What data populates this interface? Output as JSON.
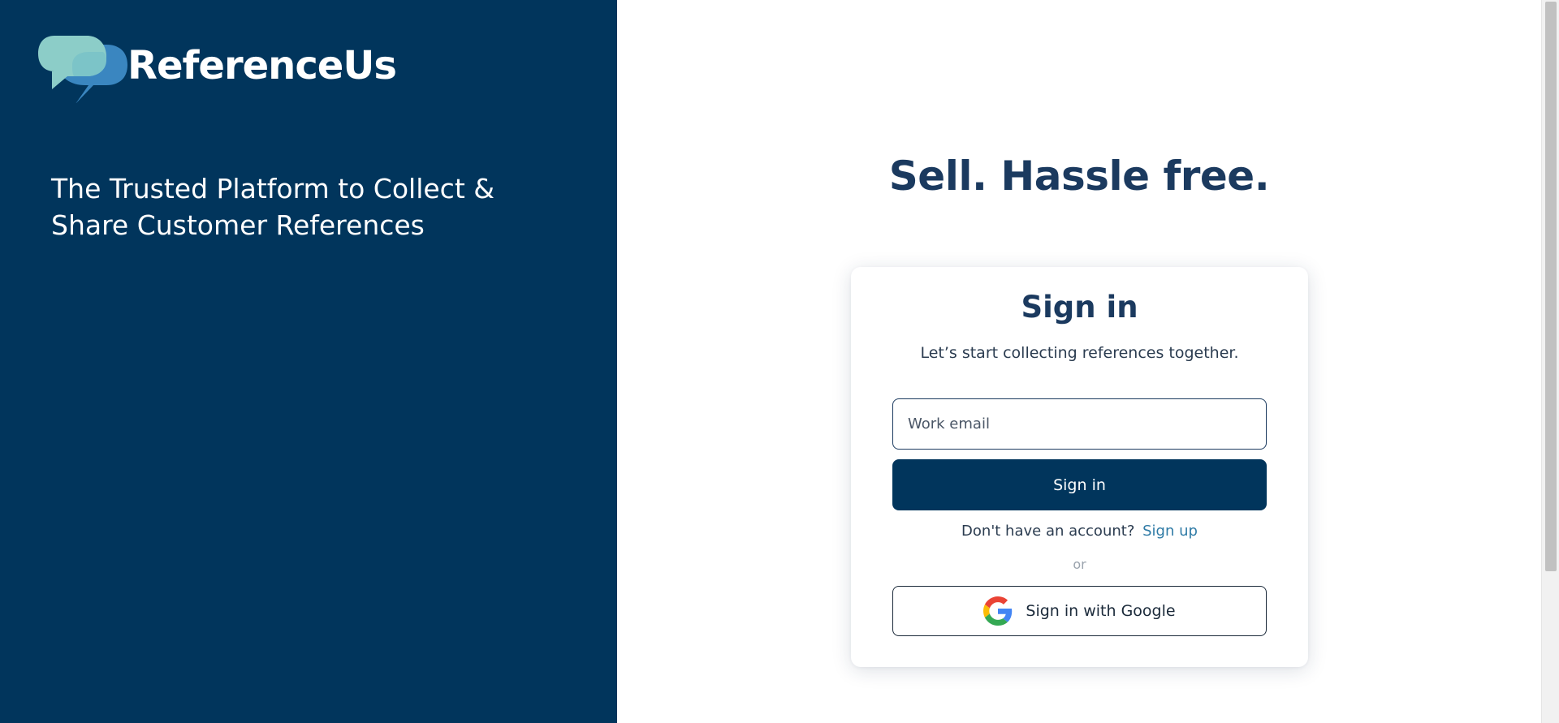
{
  "brand": {
    "name": "ReferenceUs",
    "tagline": "The Trusted Platform to Collect & Share Customer References",
    "logo_icon": "speech-bubbles-icon"
  },
  "hero": {
    "headline": "Sell. Hassle free."
  },
  "signin_card": {
    "title": "Sign in",
    "subtitle": "Let’s start collecting references together.",
    "email_placeholder": "Work email",
    "email_value": "",
    "signin_button_label": "Sign in",
    "no_account_text": "Don't have an account?",
    "signup_link_label": "Sign up",
    "divider_text": "or",
    "google_button_label": "Sign in with Google",
    "google_icon": "google-g-icon"
  },
  "colors": {
    "brand_navy": "#01355c",
    "heading_navy": "#1b3a5f",
    "link_blue": "#2f7ba6",
    "bubble_light": "#8ccdc8",
    "bubble_dark": "#3a86c0"
  }
}
